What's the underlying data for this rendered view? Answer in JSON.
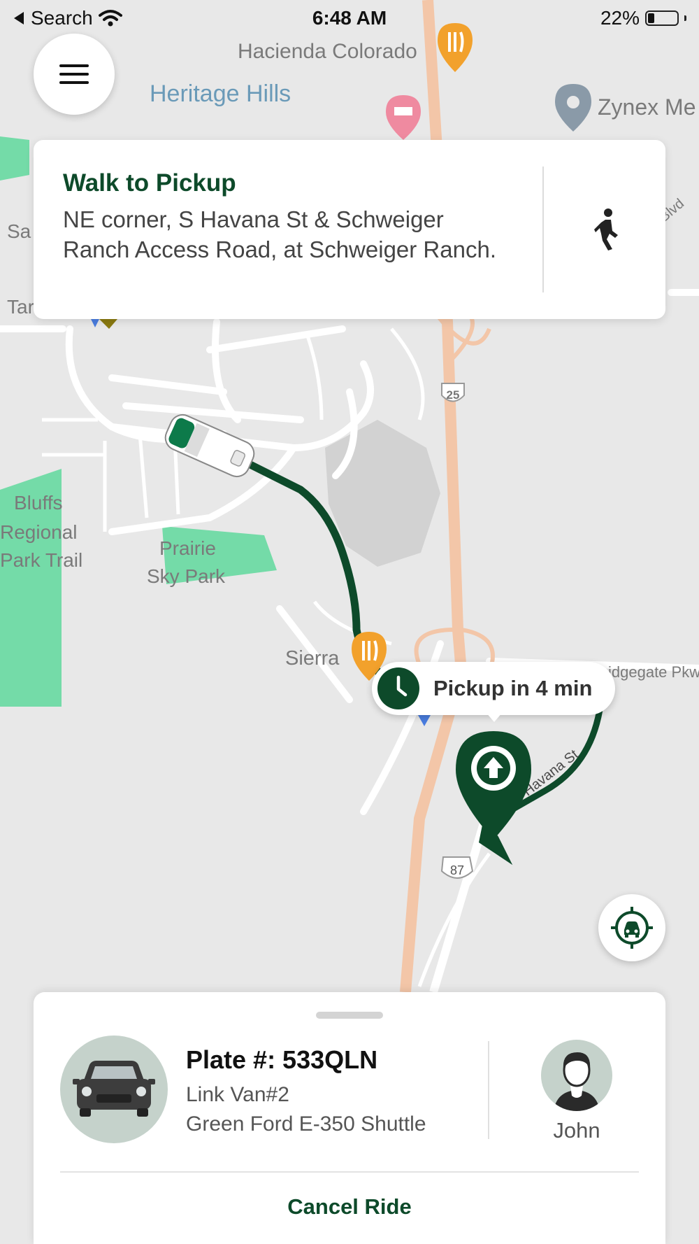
{
  "status_bar": {
    "back_label": "Search",
    "time": "6:48 AM",
    "battery_percent": "22%",
    "battery_level": 0.22
  },
  "map": {
    "labels": {
      "hacienda": "Hacienda Colorado",
      "heritage": "Heritage Hills",
      "zynex": "Zynex Me",
      "bluffs1": "Bluffs",
      "bluffs2": "Regional",
      "bluffs3": "Park Trail",
      "prairie1": "Prairie",
      "prairie2": "Sky Park",
      "sierra": "Sierra",
      "ridgegate": "idgegate Pkw",
      "havana": "S Havana St",
      "sa": "Sa",
      "tar": "Tar",
      "blvd": "Blvd",
      "hwy25": "25",
      "hwy87": "87"
    }
  },
  "walk_card": {
    "title": "Walk to Pickup",
    "description": "NE corner, S Havana St & Schweiger Ranch Access Road, at Schweiger Ranch."
  },
  "pickup_eta": {
    "label": "Pickup in 4 min"
  },
  "ride_sheet": {
    "plate": "Plate #: 533QLN",
    "vehicle_name": "Link Van#2",
    "vehicle_model": "Green Ford E-350 Shuttle",
    "driver_name": "John",
    "cancel_label": "Cancel Ride"
  },
  "colors": {
    "brand_green": "#0d4a2a",
    "park_green": "#74dba8",
    "highway_orange": "#f3c6a8",
    "poi_orange": "#f2a12c"
  }
}
